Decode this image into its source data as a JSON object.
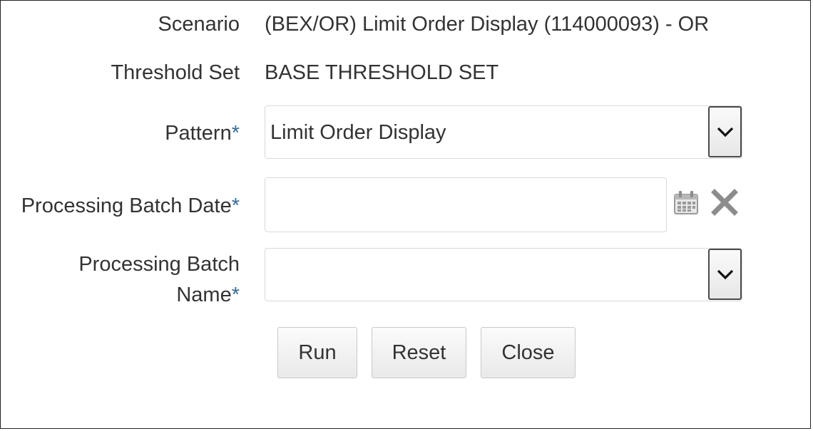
{
  "form": {
    "scenario": {
      "label": "Scenario",
      "value": "(BEX/OR) Limit Order Display (114000093) - OR"
    },
    "threshold_set": {
      "label": "Threshold Set",
      "value": "BASE THRESHOLD SET"
    },
    "pattern": {
      "label": "Pattern",
      "required_mark": "*",
      "selected": "Limit Order Display"
    },
    "processing_batch_date": {
      "label": "Processing Batch Date",
      "required_mark": "*",
      "value": ""
    },
    "processing_batch_name": {
      "label_line1": "Processing Batch",
      "label_line2": "Name",
      "required_mark": "*",
      "selected": ""
    }
  },
  "buttons": {
    "run": "Run",
    "reset": "Reset",
    "close": "Close"
  },
  "icons": {
    "calendar": "calendar-icon",
    "clear": "clear-x-icon",
    "dropdown": "chevron-down-icon"
  },
  "colors": {
    "required_mark": "#2f6da3",
    "text": "#333333"
  }
}
